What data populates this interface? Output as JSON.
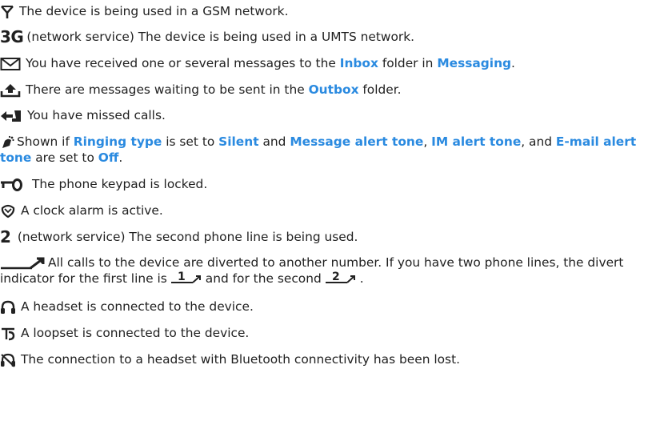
{
  "rows": [
    {
      "icon": "antenna-icon",
      "text": "The device is being used in a GSM network."
    },
    {
      "icon": "3g-icon",
      "icon_text": "3G",
      "text": "(network service) The device is being used in a UMTS network."
    },
    {
      "icon": "envelope-icon",
      "pre": "You have received one or several messages to the ",
      "link1": "Inbox",
      "mid": " folder in ",
      "link2": "Messaging",
      "post": "."
    },
    {
      "icon": "outbox-icon",
      "pre": "There are messages waiting to be sent in the ",
      "link1": "Outbox",
      "post": " folder."
    },
    {
      "icon": "missed-call-icon",
      "text": "You have missed calls."
    },
    {
      "icon": "silent-icon",
      "pre": "Shown if ",
      "link1": "Ringing type",
      "mid1": " is set to ",
      "link2": "Silent",
      "mid2": " and ",
      "link3": "Message alert tone",
      "mid3": ", ",
      "link4": "IM alert tone",
      "mid4": ", and ",
      "link5": "E-mail alert tone",
      "mid5": " are set to ",
      "link6": "Off",
      "post": "."
    },
    {
      "icon": "key-icon",
      "text": "The phone keypad is locked."
    },
    {
      "icon": "alarm-clock-icon",
      "text": "A clock alarm is active."
    },
    {
      "icon": "line-2-icon",
      "icon_text": "2",
      "text": "(network service) The second phone line is being used."
    },
    {
      "icon": "divert-icon",
      "pre": "All calls to the device are diverted to another number. If you have two phone lines, the divert indicator for the first line is",
      "line1": "1",
      "mid": "and for the second",
      "line2": "2",
      "post": "."
    },
    {
      "icon": "headset-icon",
      "text": "A headset is connected to the device."
    },
    {
      "icon": "loopset-icon",
      "text": "A loopset is connected to the device."
    },
    {
      "icon": "bluetooth-lost-icon",
      "text": "The connection to a headset with Bluetooth connectivity has been lost."
    }
  ],
  "colors": {
    "link": "#2a8ae0",
    "text": "#1f1f1f"
  }
}
